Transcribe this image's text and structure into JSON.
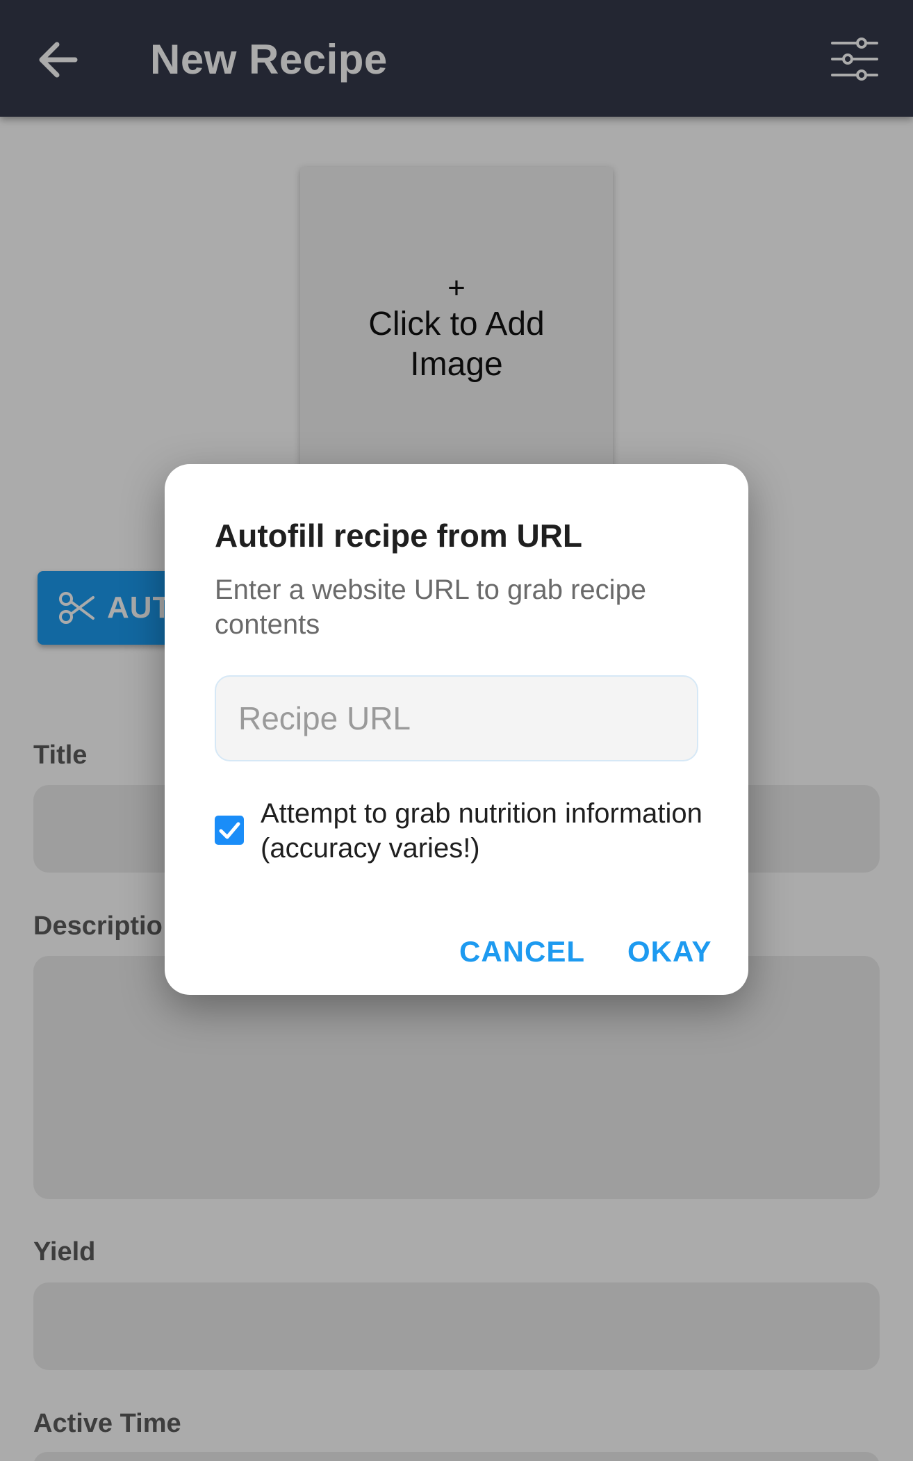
{
  "header": {
    "back_icon": "arrow-left-icon",
    "title": "New Recipe",
    "settings_icon": "sliders-icon"
  },
  "image_placeholder": {
    "plus": "+",
    "label": "Click to Add Image"
  },
  "autofill_button": {
    "icon": "scissors-icon",
    "label": "AUT"
  },
  "form": {
    "title_label": "Title",
    "description_label": "Descriptio",
    "yield_label": "Yield",
    "active_time_label": "Active Time"
  },
  "dialog": {
    "title": "Autofill recipe from URL",
    "subtitle": "Enter a website URL to grab recipe contents",
    "url_placeholder": "Recipe URL",
    "url_value": "",
    "nutrition_checkbox_checked": true,
    "nutrition_label": "Attempt to grab nutrition information (accuracy varies!)",
    "cancel_label": "CANCEL",
    "okay_label": "OKAY"
  },
  "colors": {
    "header_bg": "#353a4b",
    "accent": "#1d9af0",
    "checkbox": "#1a8df8",
    "autofill_button": "#1b9bf0"
  }
}
